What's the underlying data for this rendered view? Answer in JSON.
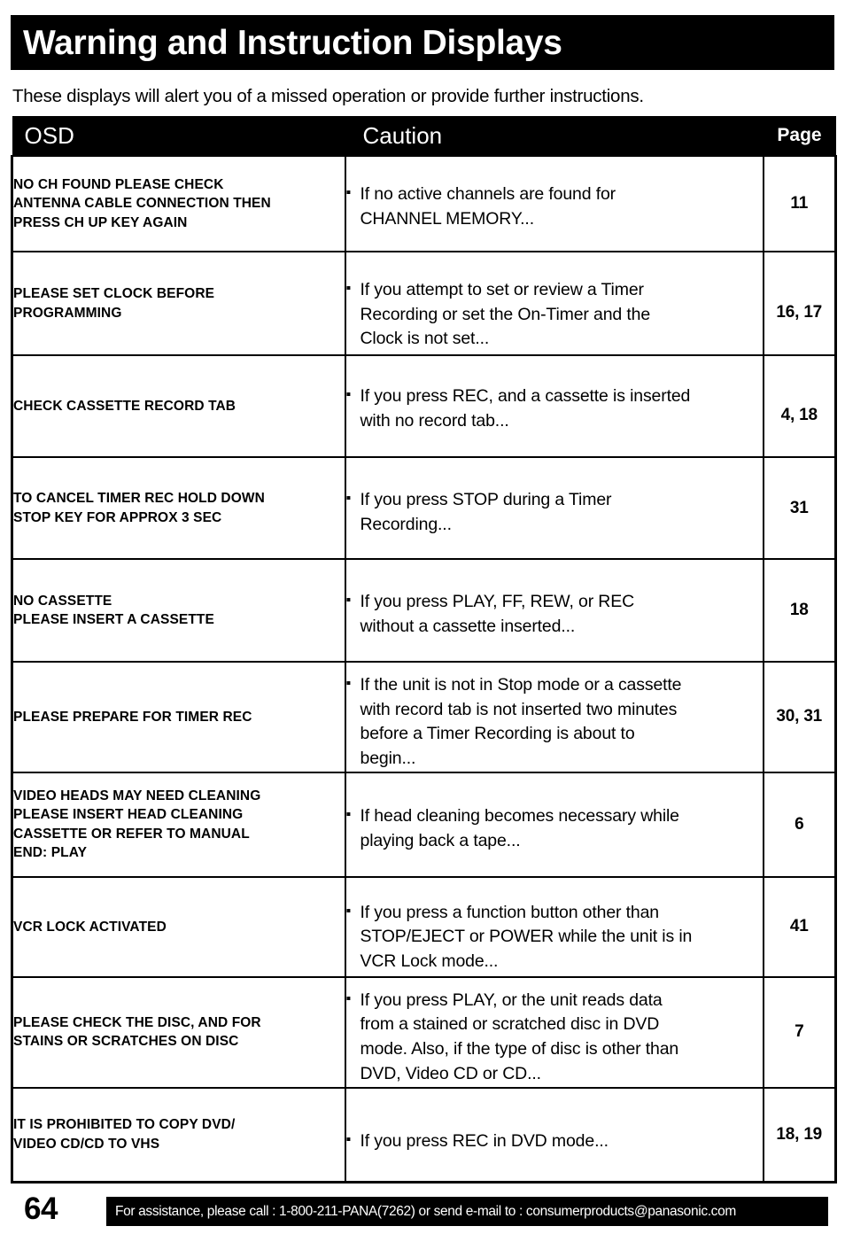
{
  "document": {
    "title": "Warning and Instruction Displays",
    "intro": "These displays will alert you of a missed operation or provide further instructions.",
    "page_number": "64"
  },
  "table": {
    "headers": {
      "osd": "OSD",
      "caution": "Caution",
      "page": "Page"
    },
    "bullet_glyph": "▪",
    "rows": [
      {
        "osd": "NO CH FOUND PLEASE CHECK\nANTENNA CABLE CONNECTION THEN\nPRESS CH UP KEY AGAIN",
        "caution": "If no active channels are found for\nCHANNEL MEMORY...",
        "page": "11"
      },
      {
        "osd": "PLEASE SET CLOCK BEFORE\nPROGRAMMING",
        "caution": "If you attempt to set or review a Timer\nRecording or set the On-Timer and the\nClock is not set...",
        "page": "16, 17"
      },
      {
        "osd": "CHECK CASSETTE RECORD TAB",
        "caution": "If you press REC, and a cassette is inserted\nwith no record tab...",
        "page": "4, 18"
      },
      {
        "osd": "TO CANCEL TIMER REC HOLD DOWN\nSTOP KEY FOR APPROX 3 SEC",
        "caution": "If you press STOP during a Timer\nRecording...",
        "page": "31"
      },
      {
        "osd": "NO CASSETTE\nPLEASE INSERT A CASSETTE",
        "caution": "If you press PLAY, FF, REW, or REC\nwithout a cassette inserted...",
        "page": "18"
      },
      {
        "osd": "PLEASE PREPARE FOR TIMER REC",
        "caution": "If the unit is not in Stop mode or a cassette\nwith record tab is not inserted two minutes\nbefore a Timer Recording is about to\nbegin...",
        "page": "30, 31"
      },
      {
        "osd": "VIDEO HEADS MAY NEED CLEANING\nPLEASE INSERT HEAD CLEANING\nCASSETTE OR REFER TO MANUAL\nEND: PLAY",
        "caution": "If head cleaning becomes necessary while\nplaying back a tape...",
        "page": "6"
      },
      {
        "osd": "VCR LOCK ACTIVATED",
        "caution": "If you press a function button other than\nSTOP/EJECT or POWER while the unit is in\nVCR Lock mode...",
        "page": "41"
      },
      {
        "osd": "PLEASE CHECK THE DISC, AND FOR\nSTAINS OR SCRATCHES ON DISC",
        "caution": "If you press PLAY, or the unit reads data\nfrom a stained or scratched disc in DVD\nmode. Also, if the type of disc is other than\nDVD, Video CD or CD...",
        "page": "7"
      },
      {
        "osd": "IT IS PROHIBITED TO COPY DVD/\nVIDEO CD/CD TO VHS",
        "caution": "If you press REC in DVD mode...",
        "page": "18, 19"
      }
    ]
  },
  "footer": {
    "contact": "For assistance, please call : 1-800-211-PANA(7262) or send e-mail to : consumerproducts@panasonic.com"
  },
  "colors": {
    "ink": "#000000",
    "paper": "#ffffff"
  }
}
